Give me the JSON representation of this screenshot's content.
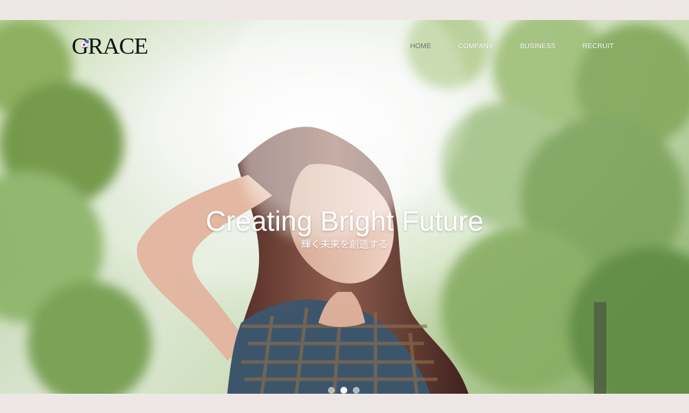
{
  "header": {
    "logo": "GRACE",
    "nav": [
      {
        "label": "HOME",
        "active": true
      },
      {
        "label": "COMPANY",
        "active": false
      },
      {
        "label": "BUSINESS",
        "active": false
      },
      {
        "label": "RECRUIT",
        "active": false
      }
    ]
  },
  "hero": {
    "title": "Creating Bright Future",
    "subtitle": "輝く未来を創造する",
    "image_subject": "woman-in-sunlit-trees",
    "carousel": {
      "slides": 3,
      "active": 2
    },
    "colors": {
      "background": "#efe7e5",
      "text": "#ffffff",
      "logo_dark": "#111111",
      "logo_accent": "#b83d98",
      "logo_accent_blue": "#4372d8"
    }
  }
}
